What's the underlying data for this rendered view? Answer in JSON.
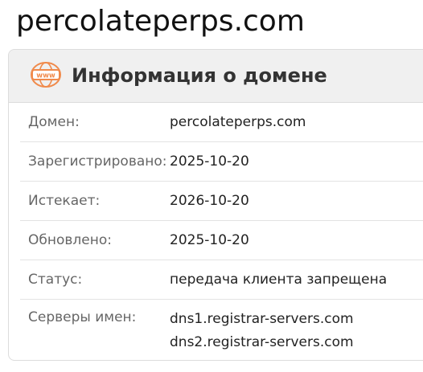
{
  "page": {
    "title": "percolateperps.com"
  },
  "card": {
    "title": "Информация о домене",
    "icon": "www-globe-icon",
    "icon_color": "#f08a4b",
    "rows": [
      {
        "label": "Домен:",
        "value": "percolateperps.com"
      },
      {
        "label": "Зарегистрировано:",
        "value": "2025-10-20"
      },
      {
        "label": "Истекает:",
        "value": "2026-10-20"
      },
      {
        "label": "Обновлено:",
        "value": "2025-10-20"
      },
      {
        "label": "Статус:",
        "value": "передача клиента запрещена"
      },
      {
        "label": "Серверы имен:",
        "values": [
          "dns1.registrar-servers.com",
          "dns2.registrar-servers.com"
        ]
      }
    ]
  }
}
